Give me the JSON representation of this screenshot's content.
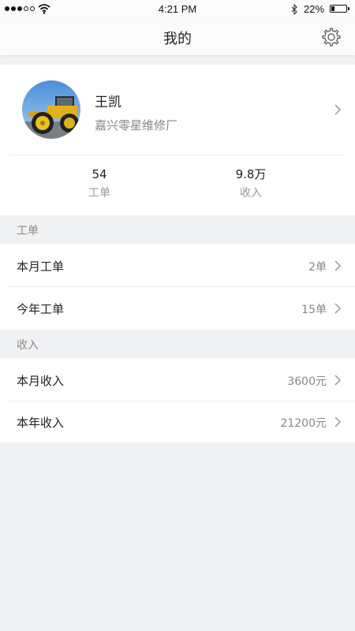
{
  "status_bar": {
    "time": "4:21 PM",
    "battery_percent": "22%",
    "battery_level": 0.22,
    "signal_bars_filled": 3,
    "signal_bars_total": 5
  },
  "nav": {
    "title": "我的",
    "settings_icon": "gear-icon"
  },
  "profile": {
    "name": "王凯",
    "company": "嘉兴零星维修厂",
    "avatar_icon": "avatar"
  },
  "stats": {
    "orders_value": "54",
    "orders_label": "工单",
    "income_value": "9.8万",
    "income_label": "收入"
  },
  "sections": {
    "orders": {
      "header": "工单",
      "items": [
        {
          "label": "本月工单",
          "value": "2单"
        },
        {
          "label": "今年工单",
          "value": "15单"
        }
      ]
    },
    "income": {
      "header": "收入",
      "items": [
        {
          "label": "本月收入",
          "value": "3600元"
        },
        {
          "label": "本年收入",
          "value": "21200元"
        }
      ]
    }
  },
  "colors": {
    "background": "#f0f1f3",
    "card": "#ffffff",
    "primary_text": "#222222",
    "secondary_text": "#888888",
    "divider": "#ececec"
  }
}
